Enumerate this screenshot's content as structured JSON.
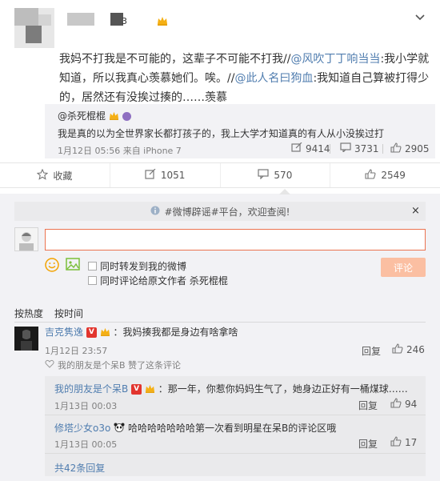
{
  "header": {
    "name_suffix": "3"
  },
  "post": {
    "segments": [
      {
        "t": "我妈不打我是不可能的，这辈子不可能不打我//",
        "c": ""
      },
      {
        "t": "@风吹丁丁响当当",
        "c": "blue"
      },
      {
        "t": ":我小学就知道，所以我真心羡慕她们。唉。//",
        "c": ""
      },
      {
        "t": "@此人名曰狗血",
        "c": "blue"
      },
      {
        "t": ":我知道自己算被打得少的，居然还有没挨过揍的……羡慕",
        "c": ""
      }
    ]
  },
  "repost": {
    "user": "@杀死棍棍",
    "text": "我是真的以为全世界家长都打孩子的，我上大学才知道真的有人从小没挨过打",
    "meta": "1月12日 05:56 来自 iPhone 7",
    "stats": {
      "reposts": "9414",
      "comments": "3731",
      "likes": "2905"
    }
  },
  "actions": {
    "favorite": "收藏",
    "repost": "1051",
    "comment": "570",
    "like": "2549"
  },
  "comment_box": {
    "notice": "#微博辟谣#平台，欢迎查阅!",
    "close": "×",
    "option_repost": "同时转发到我的微博",
    "option_comment_origin": "同时评论给原文作者 杀死棍棍",
    "submit": "评论"
  },
  "sort": {
    "hot": "按热度",
    "time": "按时间"
  },
  "comments": [
    {
      "user": "吉克隽逸",
      "text": "：我妈揍我都是身边有啥拿啥",
      "time": "1月12日 23:57",
      "reply": "回复",
      "likes": "246",
      "liked_by": "我的朋友是个呆B 赞了这条评论",
      "replies": [
        {
          "user": "我的朋友是个呆B",
          "text": "：那一年，你惹你妈妈生气了，她身边正好有一桶煤球……",
          "time": "1月13日 00:03",
          "reply": "回复",
          "likes": "94"
        },
        {
          "user": "修塔少女o3o",
          "text": "哈哈哈哈哈哈哈第一次看到明星在呆B的评论区哦",
          "time": "1月13日 00:05",
          "reply": "回复",
          "likes": "17"
        }
      ],
      "more_replies": "共42条回复"
    }
  ],
  "colors": {
    "accent": "#eb7350",
    "link": "#507daf",
    "vip_badge": "#e2352e",
    "panel": "#f2f2f5"
  }
}
